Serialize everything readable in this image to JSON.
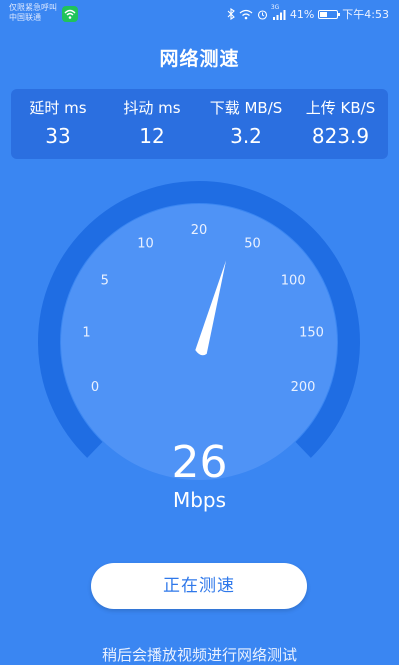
{
  "status_bar": {
    "carrier_line1": "仅限紧急呼叫",
    "carrier_line2": "中国联通",
    "network_type": "3G",
    "battery_percent": "41%",
    "battery_level": 0.41,
    "time": "下午4:53"
  },
  "header": {
    "title": "网络测速"
  },
  "stats": [
    {
      "label": "延时 ms",
      "value": "33"
    },
    {
      "label": "抖动 ms",
      "value": "12"
    },
    {
      "label": "下载 MB/S",
      "value": "3.2"
    },
    {
      "label": "上传 KB/S",
      "value": "823.9"
    }
  ],
  "gauge": {
    "scale_labels": [
      "0",
      "1",
      "5",
      "10",
      "20",
      "50",
      "100",
      "150",
      "200"
    ],
    "needle_at_label_index": 4.65
  },
  "speed": {
    "value": "26",
    "unit": "Mbps"
  },
  "action": {
    "button_label": "正在测速"
  },
  "footer": {
    "note": "稍后会播放视频进行网络测试"
  },
  "colors": {
    "background": "#3a86f2",
    "card": "#2b6fe0",
    "gauge_arc": "#1f6de3",
    "gauge_inner": "#4f93f6",
    "button_bg": "#ffffff",
    "button_text": "#2f78ea",
    "wifi_badge": "#20c35a"
  },
  "icons": [
    "wifi-icon",
    "bluetooth-icon",
    "alarm-icon",
    "signal-icon",
    "battery-icon"
  ]
}
